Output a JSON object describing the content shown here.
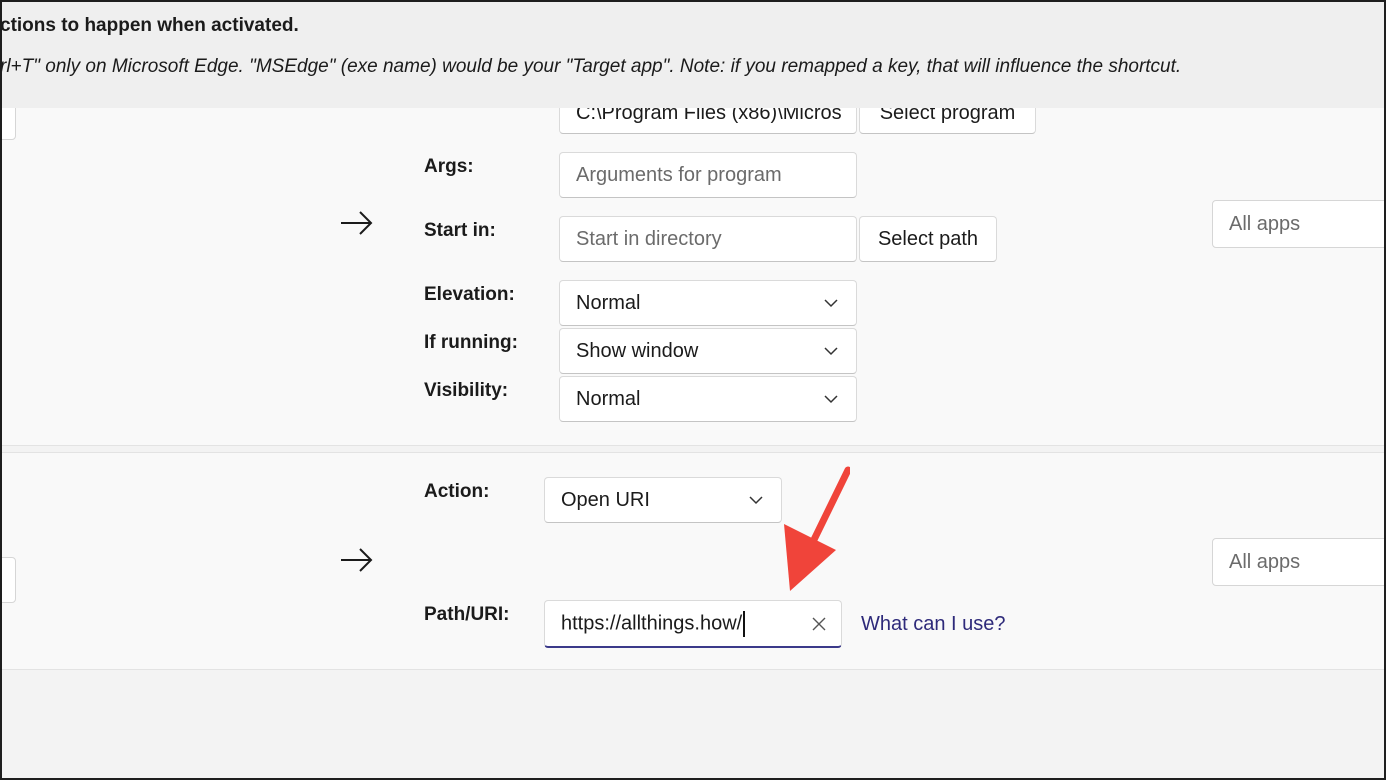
{
  "header": {
    "title": "ctions to happen when activated.",
    "description": "rl+T\" only on Microsoft Edge. \"MSEdge\" (exe name) would be your \"Target app\". Note: if you remapped a key, that will influence the shortcut."
  },
  "run_program": {
    "app_value": "C:\\Program Files (x86)\\Micros",
    "select_program_label": "Select program",
    "args_label": "Args:",
    "args_placeholder": "Arguments for program",
    "start_in_label": "Start in:",
    "start_in_placeholder": "Start in directory",
    "select_path_label": "Select path",
    "elevation_label": "Elevation:",
    "elevation_value": "Normal",
    "if_running_label": "If running:",
    "if_running_value": "Show window",
    "visibility_label": "Visibility:",
    "visibility_value": "Normal",
    "target_app_placeholder": "All apps"
  },
  "open_uri": {
    "action_label": "Action:",
    "action_value": "Open URI",
    "path_label": "Path/URI:",
    "path_value": "https://allthings.how/",
    "help_link": "What can I use?",
    "target_app_placeholder": "All apps"
  },
  "annotation": {
    "arrow_color": "#f0443a"
  },
  "icons": [
    "arrow-right-icon",
    "chevron-down-icon",
    "clear-icon"
  ]
}
